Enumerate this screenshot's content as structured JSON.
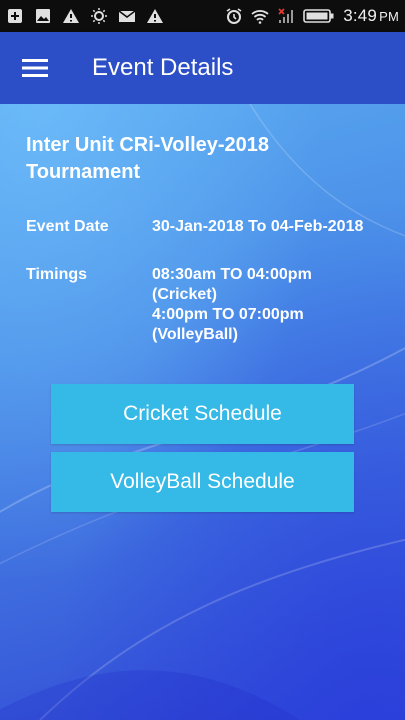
{
  "status_bar": {
    "time": "3:49",
    "ampm": "PM",
    "left_icons": [
      "add-box-icon",
      "image-icon",
      "warning-icon",
      "brightness-icon",
      "mail-icon",
      "warning-icon"
    ],
    "right_icons": [
      "alarm-icon",
      "wifi-icon",
      "signal-icon",
      "battery-icon"
    ]
  },
  "app_bar": {
    "title": "Event Details",
    "menu_icon": "hamburger-menu-icon"
  },
  "event": {
    "title": "Inter Unit CRi-Volley-2018 Tournament",
    "date_label": "Event Date",
    "date_value": "30-Jan-2018 To 04-Feb-2018",
    "timings_label": "Timings",
    "timings_lines": [
      "08:30am TO 04:00pm",
      "(Cricket)",
      "4:00pm TO 07:00pm",
      "(VolleyBall)"
    ]
  },
  "buttons": {
    "cricket": "Cricket Schedule",
    "volleyball": "VolleyBall Schedule"
  },
  "colors": {
    "status_bar": "#0d0d0d",
    "app_bar": "#2c4fc7",
    "button": "#35b9e6",
    "background_top": "#5aa8f0",
    "background_bottom": "#3046d6"
  }
}
